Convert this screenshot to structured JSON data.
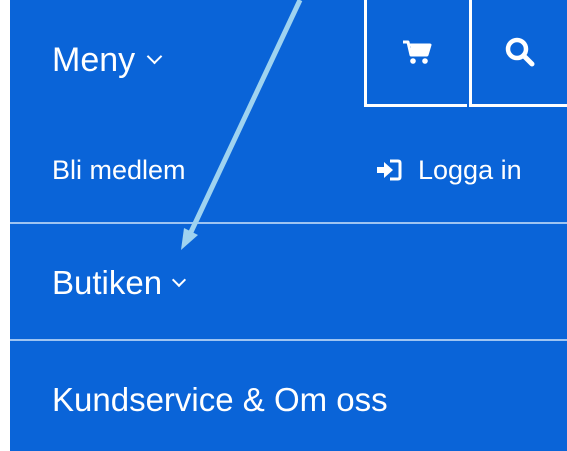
{
  "header": {
    "menu_label": "Meny"
  },
  "icons": {
    "menu_chevron": "chevron-down-icon",
    "cart": "cart-icon",
    "search": "search-icon",
    "login": "sign-in-icon"
  },
  "account": {
    "join_label": "Bli medlem",
    "login_label": "Logga in"
  },
  "nav": {
    "items": [
      {
        "label": "Butiken"
      },
      {
        "label": "Kundservice & Om oss"
      }
    ]
  },
  "colors": {
    "panel_bg": "#0a64d8",
    "divider": "#9ec4f2",
    "annotation_arrow": "#9fd3f0"
  }
}
